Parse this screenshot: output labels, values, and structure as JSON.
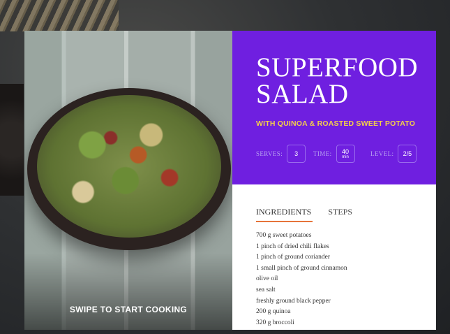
{
  "photo": {
    "caption": "SWIPE TO START COOKING"
  },
  "recipe": {
    "title_line1": "SUPERFOOD",
    "title_line2": "SALAD",
    "subtitle": "WITH QUINOA & ROASTED SWEET POTATO",
    "meta": {
      "serves_label": "SERVES:",
      "serves_value": "3",
      "time_label": "TIME:",
      "time_value": "40",
      "time_unit": "min",
      "level_label": "LEVEL:",
      "level_value": "2/5"
    },
    "tabs": [
      {
        "label": "INGREDIENTS",
        "active": true
      },
      {
        "label": "STEPS",
        "active": false
      }
    ],
    "ingredients": [
      "700  g sweet potatoes",
      "1 pinch of dried chili flakes",
      "1 pinch of ground coriander",
      "1 small pinch of ground cinnamon",
      "olive oil",
      "sea salt",
      "freshly ground black pepper",
      "200 g quinoa",
      "320 g broccoli"
    ]
  },
  "colors": {
    "hero_bg": "#6f1fe0",
    "subtitle": "#f4cf4a",
    "tab_underline": "#e6733a"
  }
}
